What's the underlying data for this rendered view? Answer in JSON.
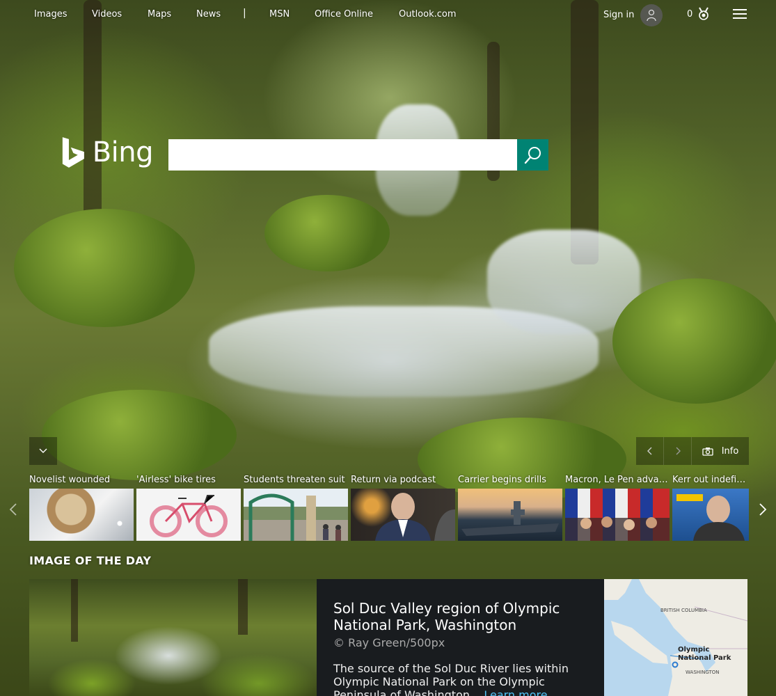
{
  "nav": {
    "links": [
      "Images",
      "Videos",
      "Maps",
      "News"
    ],
    "separator": "|",
    "links_right": [
      "MSN",
      "Office Online",
      "Outlook.com"
    ],
    "sign_in": "Sign in",
    "rewards_count": "0"
  },
  "search": {
    "logo_text": "Bing",
    "query": "",
    "placeholder": ""
  },
  "hero": {
    "info_label": "Info"
  },
  "news": [
    {
      "title": "Novelist wounded"
    },
    {
      "title": "'Airless' bike tires"
    },
    {
      "title": "Students threaten suit"
    },
    {
      "title": "Return via podcast"
    },
    {
      "title": "Carrier begins drills"
    },
    {
      "title": "Macron, Le Pen advance"
    },
    {
      "title": "Kerr out indefinitely"
    }
  ],
  "image_of_the_day": {
    "heading": "IMAGE OF THE DAY",
    "title": "Sol Duc Valley region of Olympic National Park, Washington",
    "credit": "© Ray Green/500px",
    "description": "The source of the Sol Duc River lies within Olympic National Park on the Olympic Peninsula of Washington...",
    "learn_more": "Learn more",
    "map_labels": {
      "region": "BRITISH COLUMBIA",
      "park": "Olympic National Park",
      "state": "WASHINGTON"
    }
  },
  "colors": {
    "search_button": "#008373",
    "link_accent": "#4fc3f7"
  }
}
